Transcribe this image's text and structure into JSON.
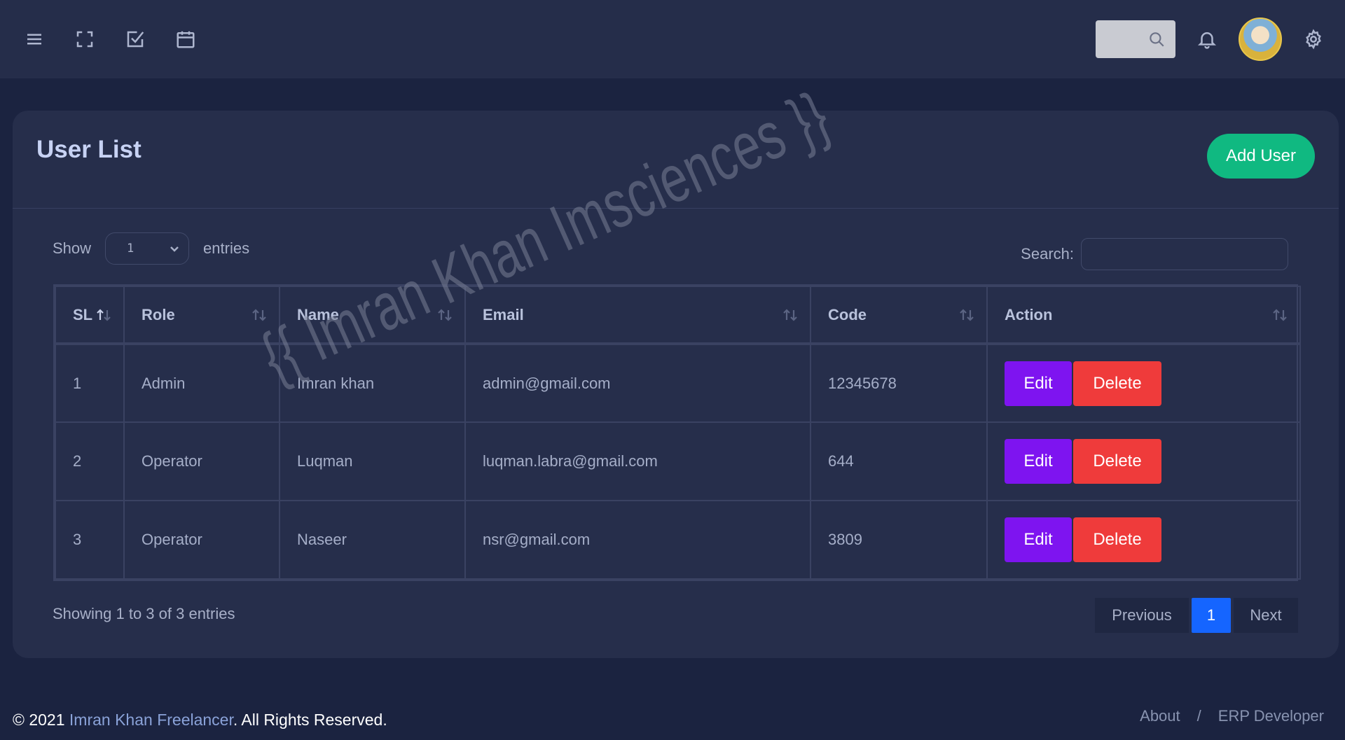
{
  "topbar": {
    "icons": [
      "menu-icon",
      "fullscreen-icon",
      "checkbox-icon",
      "calendar-icon"
    ],
    "right_icons": [
      "search-icon",
      "bell-icon",
      "avatar",
      "gear-icon"
    ]
  },
  "card": {
    "title": "User List",
    "add_button": "Add User"
  },
  "controls": {
    "show_label": "Show",
    "length_value": "1",
    "entries_label": "entries",
    "search_label": "Search:",
    "search_value": ""
  },
  "table": {
    "headers": [
      "SL",
      "Role",
      "Name",
      "Email",
      "Code",
      "Action"
    ],
    "rows": [
      {
        "sl": "1",
        "role": "Admin",
        "name": "Imran khan",
        "email": "admin@gmail.com",
        "code": "12345678"
      },
      {
        "sl": "2",
        "role": "Operator",
        "name": "Luqman",
        "email": "luqman.labra@gmail.com",
        "code": "644"
      },
      {
        "sl": "3",
        "role": "Operator",
        "name": "Naseer",
        "email": "nsr@gmail.com",
        "code": "3809"
      }
    ],
    "edit_label": "Edit",
    "delete_label": "Delete"
  },
  "pagination": {
    "info": "Showing 1 to 3 of 3 entries",
    "previous": "Previous",
    "current": "1",
    "next": "Next"
  },
  "watermark": "{{ Imran Khan Imsciences }}",
  "footer": {
    "copyright": "© 2021",
    "brand": "Imran Khan Freelancer",
    "rights": ". All Rights Reserved.",
    "separator": "/",
    "links": [
      "About",
      "ERP Developer"
    ]
  },
  "colors": {
    "background": "#1b2340",
    "card": "#262e4b",
    "add_user": "#10b981",
    "edit": "#7e14f0",
    "delete": "#ef3b3b",
    "page_active": "#1565ff"
  }
}
